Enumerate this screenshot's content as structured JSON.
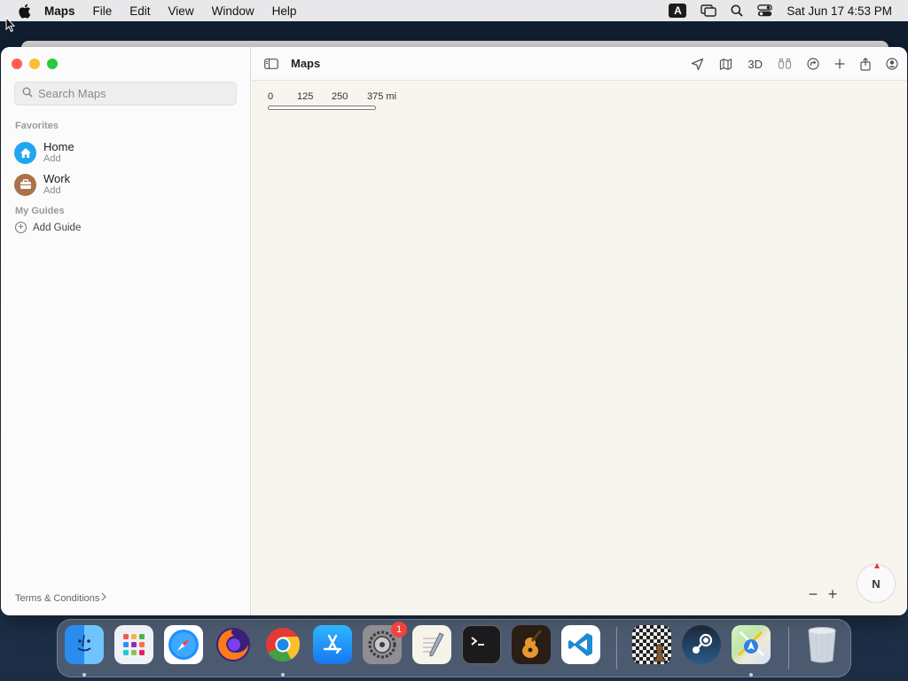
{
  "menubar": {
    "app_name": "Maps",
    "items": [
      "File",
      "Edit",
      "View",
      "Window",
      "Help"
    ],
    "input_source": "A",
    "clock": "Sat Jun 17  4:53 PM"
  },
  "sidebar": {
    "search_placeholder": "Search Maps",
    "favorites_label": "Favorites",
    "favorites": [
      {
        "title": "Home",
        "subtitle": "Add",
        "icon": "house-icon",
        "color": "#1fa7f0"
      },
      {
        "title": "Work",
        "subtitle": "Add",
        "icon": "briefcase-icon",
        "color": "#a8734a"
      }
    ],
    "guides_label": "My Guides",
    "add_guide_label": "Add Guide",
    "terms_label": "Terms & Conditions"
  },
  "toolbar": {
    "title": "Maps",
    "threed_label": "3D"
  },
  "map": {
    "scale_ticks": [
      "0",
      "125",
      "250",
      "375 mi"
    ],
    "compass_label": "N",
    "zoom_out": "−",
    "zoom_in": "+"
  },
  "dock": {
    "apps": [
      {
        "name": "Finder",
        "running": true
      },
      {
        "name": "Launchpad",
        "running": false
      },
      {
        "name": "Safari",
        "running": false
      },
      {
        "name": "Firefox",
        "running": false
      },
      {
        "name": "Chrome",
        "running": true
      },
      {
        "name": "App Store",
        "running": false
      },
      {
        "name": "System Preferences",
        "running": false,
        "badge": "1"
      },
      {
        "name": "TextEdit",
        "running": false
      },
      {
        "name": "Terminal",
        "running": false
      },
      {
        "name": "GarageBand",
        "running": false
      },
      {
        "name": "VS Code",
        "running": false
      },
      {
        "name": "Chess",
        "running": false
      },
      {
        "name": "Steam",
        "running": false
      },
      {
        "name": "Maps",
        "running": true
      },
      {
        "name": "Trash",
        "running": false
      }
    ]
  },
  "colors": {
    "close": "#ff5f57",
    "minimize": "#febc2e",
    "zoom": "#28c840",
    "map_background": "#f8f4ee"
  }
}
